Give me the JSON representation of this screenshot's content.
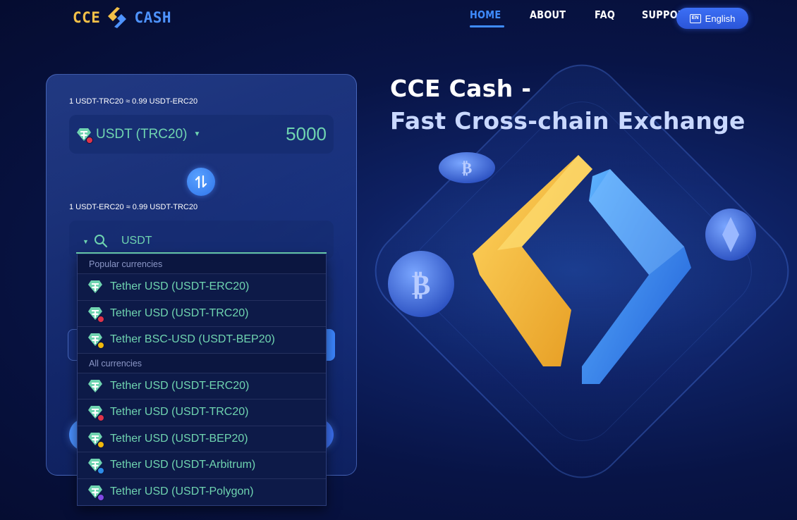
{
  "brand": {
    "name_left": "CCE",
    "name_right": "CASH",
    "logo_icon": "cce-cash-logo"
  },
  "nav": {
    "items": [
      {
        "label": "HOME",
        "active": true
      },
      {
        "label": "ABOUT",
        "active": false
      },
      {
        "label": "FAQ",
        "active": false
      },
      {
        "label": "SUPPORT",
        "active": false
      }
    ],
    "language": {
      "code": "EN",
      "label": "English",
      "icon": "language-icon"
    }
  },
  "hero": {
    "title_line1": "CCE Cash -",
    "title_line2": "Fast Cross-chain Exchange"
  },
  "exchange": {
    "rate_from": "1 USDT-TRC20 ≈ 0.99 USDT-ERC20",
    "from": {
      "currency": "USDT (TRC20)",
      "amount": "5000",
      "icon": "tether-icon"
    },
    "swap_icon": "swap-arrows-icon",
    "rate_to": "1 USDT-ERC20 ≈ 0.99 USDT-TRC20",
    "search": {
      "value": "USDT",
      "icon": "search-icon"
    }
  },
  "dropdown": {
    "popular_header": "Popular currencies",
    "popular": [
      {
        "label": "Tether USD (USDT-ERC20)",
        "chain": "erc20"
      },
      {
        "label": "Tether USD (USDT-TRC20)",
        "chain": "trc20"
      },
      {
        "label": "Tether BSC-USD (USDT-BEP20)",
        "chain": "bep20"
      }
    ],
    "all_header": "All currencies",
    "all": [
      {
        "label": "Tether USD (USDT-ERC20)",
        "chain": "erc20"
      },
      {
        "label": "Tether USD (USDT-TRC20)",
        "chain": "trc20"
      },
      {
        "label": "Tether USD (USDT-BEP20)",
        "chain": "bep20"
      },
      {
        "label": "Tether USD (USDT-Arbitrum)",
        "chain": "arbitrum"
      },
      {
        "label": "Tether USD (USDT-Polygon)",
        "chain": "polygon"
      }
    ]
  },
  "colors": {
    "accent": "#3f8cff",
    "tether_green": "#6fd4b0",
    "gold": "#f3c048",
    "chain_trc20": "#e0334a",
    "chain_bep20": "#f0b90b",
    "chain_arbitrum": "#2d8ce8",
    "chain_polygon": "#8247e5"
  }
}
